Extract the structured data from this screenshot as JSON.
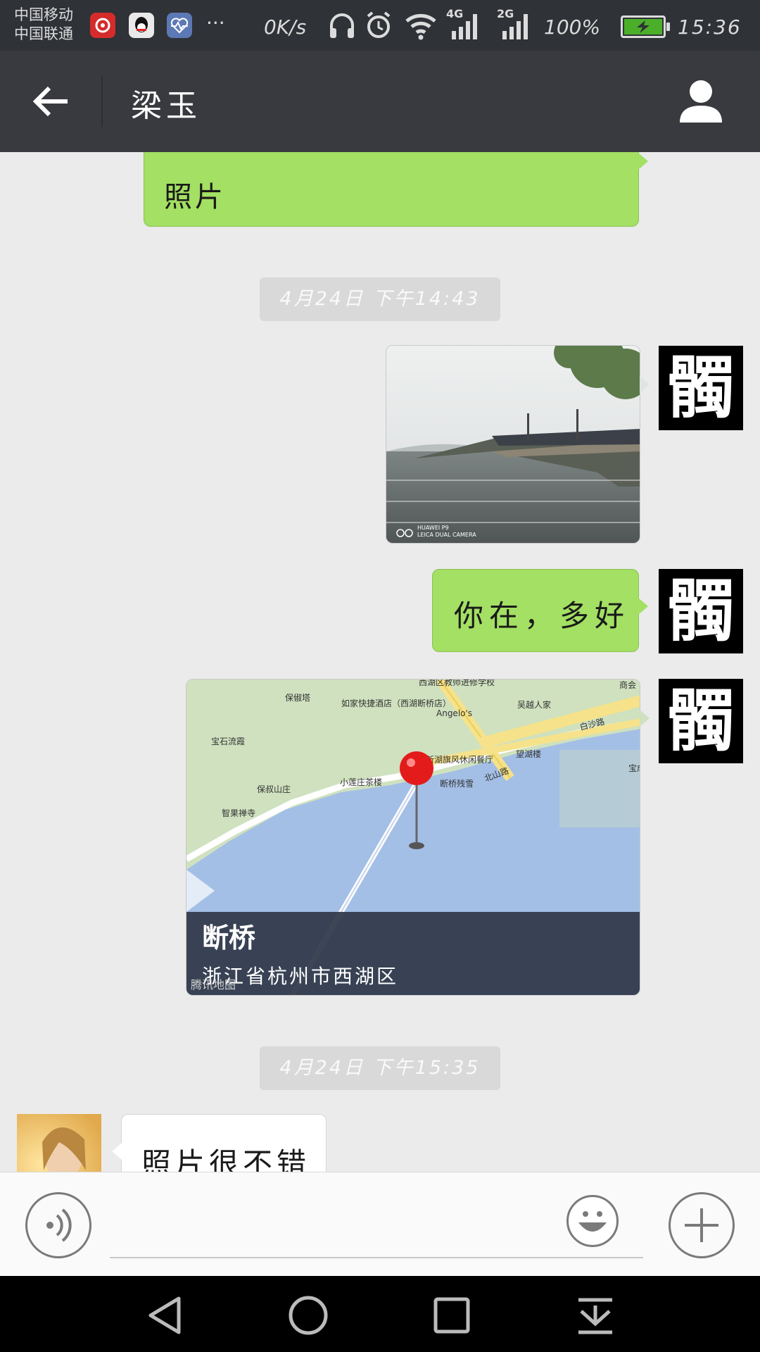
{
  "status_bar": {
    "carrier_1": "中国移动",
    "carrier_2": "中国联通",
    "more": "···",
    "speed": "0K/s",
    "net_1": "4G",
    "net_2": "2G",
    "battery": "100%",
    "battery_level": 1.0,
    "time": "15:36",
    "icons": [
      "netease-music-icon",
      "qq-icon",
      "health-icon",
      "headphones-icon",
      "alarm-icon",
      "wifi-icon",
      "signal-icon",
      "battery-icon"
    ]
  },
  "header": {
    "title": "梁玉",
    "back_icon": "arrow-left-icon",
    "profile_icon": "person-icon"
  },
  "messages": {
    "partial_top": "照片",
    "timestamp_1": "4月24日  下午14:43",
    "photo_watermark_1": "HUAWEI P9",
    "photo_watermark_2": "LEICA DUAL CAMERA",
    "text_me": "你在，多好",
    "location": {
      "title": "断桥",
      "address": "浙江省杭州市西湖区",
      "map_logo": "腾讯地图",
      "labels": [
        "西湖区教师进修学校",
        "保俶塔",
        "如家快捷酒店（西湖断桥店）",
        "Angelo's",
        "吴越人家",
        "白沙路",
        "宝石流霞",
        "望湖楼",
        "新湖旗风休闲餐厅",
        "小莲庄茶楼",
        "断桥残雪",
        "北山路",
        "保叔山庄",
        "智果禅寺",
        "商会",
        "宝成"
      ]
    },
    "timestamp_2": "4月24日  下午15:35",
    "text_other": "照片很不错",
    "my_avatar_char": "髑"
  },
  "input": {
    "voice_icon": "voice-icon",
    "emoji_icon": "smiley-icon",
    "plus_icon": "plus-icon",
    "value": ""
  },
  "navbar": {
    "icons": [
      "nav-back-icon",
      "nav-home-icon",
      "nav-recent-icon",
      "nav-notification-icon"
    ]
  },
  "colors": {
    "status_bg": "#2f3237",
    "header_bg": "#393a3f",
    "chat_bg": "#ebebeb",
    "my_bubble": "#a3e063",
    "other_bubble": "#ffffff",
    "battery": "#4caf2a",
    "map_water": "#a3bfe6",
    "map_land": "#cfe1bf",
    "pin": "#e31b1b"
  }
}
